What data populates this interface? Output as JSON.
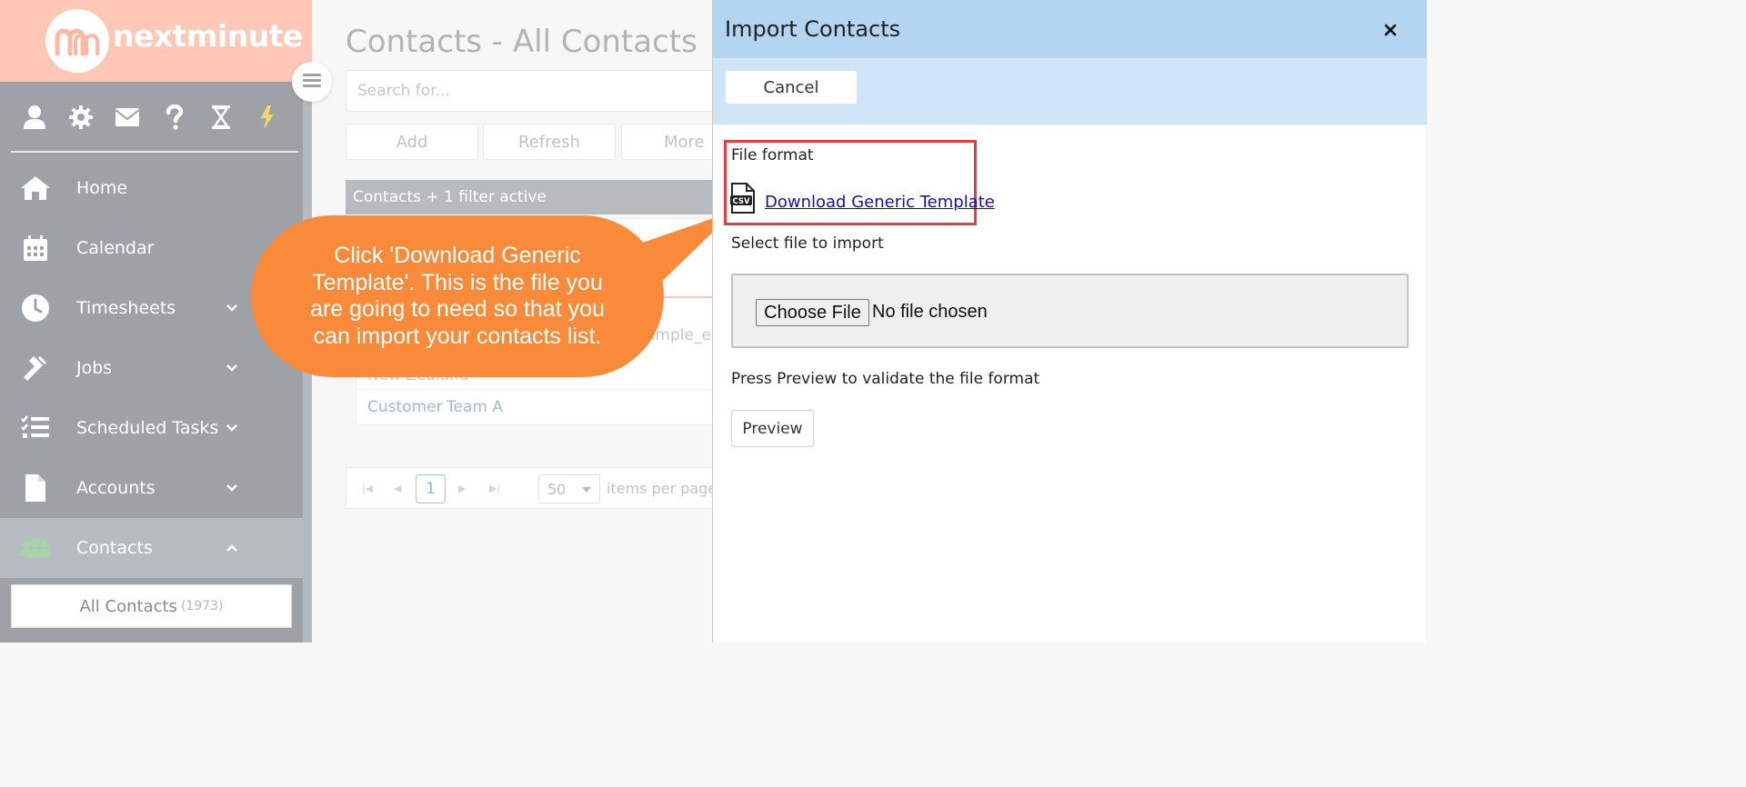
{
  "brand": {
    "logo_mark": "m",
    "logo_text": "nextminute"
  },
  "sidebar": {
    "top_icons": [
      "user-icon",
      "gear-icon",
      "envelope-icon",
      "question-icon",
      "hourglass-icon",
      "bolt-icon"
    ],
    "items": [
      {
        "label": "Home",
        "icon": "home-icon"
      },
      {
        "label": "Calendar",
        "icon": "calendar-icon"
      },
      {
        "label": "Timesheets",
        "icon": "clock-icon"
      },
      {
        "label": "Jobs",
        "icon": "hammer-icon"
      },
      {
        "label": "Scheduled Tasks",
        "icon": "tasks-icon"
      },
      {
        "label": "Accounts",
        "icon": "document-icon"
      },
      {
        "label": "Contacts",
        "icon": "users-icon"
      }
    ],
    "sub_item": {
      "label": "All Contacts",
      "count": "(1973)"
    }
  },
  "main": {
    "title": "Contacts - All Contacts",
    "search_placeholder": "Search for...",
    "toolbar": {
      "add": "Add",
      "refresh": "Refresh",
      "more": "More"
    },
    "filter_bar": "Contacts + 1 filter active",
    "card": {
      "email_fragment": "ample_er",
      "country": "New Zealand",
      "tags": [
        "Customer",
        "Team A"
      ]
    },
    "pager": {
      "current_page": "1",
      "page_size": "50",
      "label": "items per page"
    }
  },
  "callout": {
    "text": "Click 'Download Generic Template'. This is the file you are going to need so that you can import your contacts list.",
    "color": "#f98a3a"
  },
  "import_panel": {
    "title": "Import Contacts",
    "close": "×",
    "cancel": "Cancel",
    "file_format_label": "File format",
    "download_link": "Download Generic Template",
    "select_file_label": "Select file to import",
    "choose_file": "Choose File",
    "no_file": "No file chosen",
    "preview_hint": "Press Preview to validate the file format",
    "preview": "Preview",
    "highlight_color": "#e43d3d"
  }
}
